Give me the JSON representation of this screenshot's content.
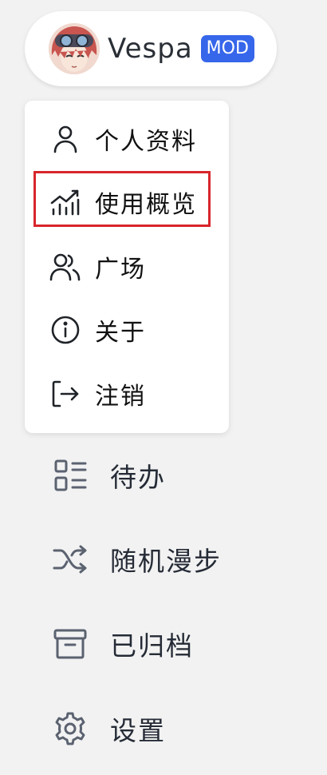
{
  "profile": {
    "username": "Vespa",
    "badge": "MOD",
    "badge_color": "#3666ea"
  },
  "dropdown": {
    "items": [
      {
        "label": "个人资料",
        "icon": "user-icon"
      },
      {
        "label": "使用概览",
        "icon": "chart-line-icon",
        "highlighted": true
      },
      {
        "label": "广场",
        "icon": "users-icon"
      },
      {
        "label": "关于",
        "icon": "info-icon"
      },
      {
        "label": "注销",
        "icon": "logout-icon"
      }
    ],
    "highlight_color": "#d8262c"
  },
  "nav": {
    "items": [
      {
        "label": "待办",
        "icon": "list-icon"
      },
      {
        "label": "随机漫步",
        "icon": "shuffle-icon"
      },
      {
        "label": "已归档",
        "icon": "archive-icon"
      },
      {
        "label": "设置",
        "icon": "gear-icon"
      }
    ]
  }
}
